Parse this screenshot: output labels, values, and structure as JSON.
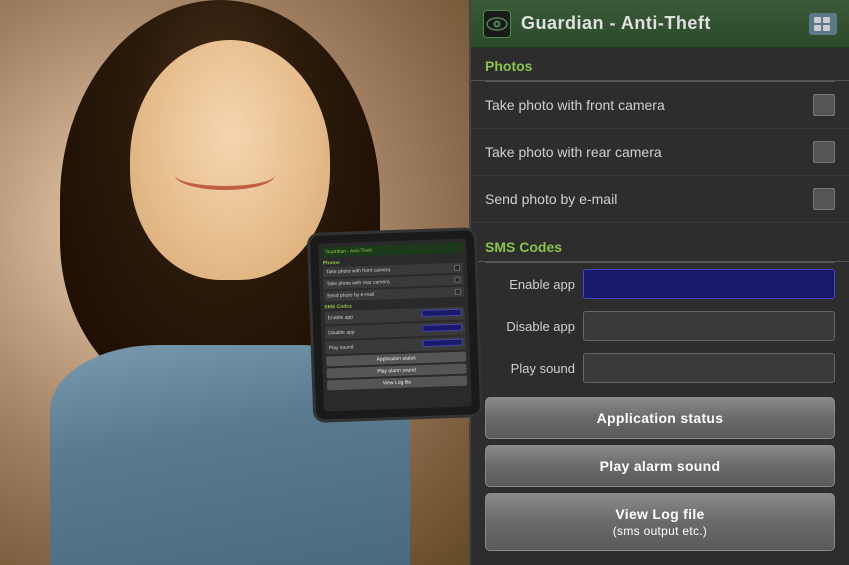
{
  "app": {
    "title": "Guardian - Anti-Theft",
    "header_icon_alt": "eye-icon",
    "right_icon_alt": "menu-icon"
  },
  "photos_section": {
    "label": "Photos",
    "options": [
      {
        "id": "front-camera",
        "label": "Take photo with front camera",
        "checked": false
      },
      {
        "id": "rear-camera",
        "label": "Take photo with rear camera",
        "checked": false
      },
      {
        "id": "send-email",
        "label": "Send photo by e-mail",
        "checked": false
      }
    ]
  },
  "sms_codes_section": {
    "label": "SMS Codes",
    "fields": [
      {
        "id": "enable-app",
        "label": "Enable app",
        "value": "",
        "highlighted": true
      },
      {
        "id": "disable-app",
        "label": "Disable app",
        "value": ""
      },
      {
        "id": "play-sound",
        "label": "Play sound",
        "value": ""
      }
    ]
  },
  "action_buttons": [
    {
      "id": "app-status",
      "label": "Application status"
    },
    {
      "id": "play-alarm",
      "label": "Play alarm sound"
    },
    {
      "id": "view-log",
      "label": "View Log file\n(sms output etc.)"
    }
  ],
  "tablet": {
    "visible": true
  }
}
